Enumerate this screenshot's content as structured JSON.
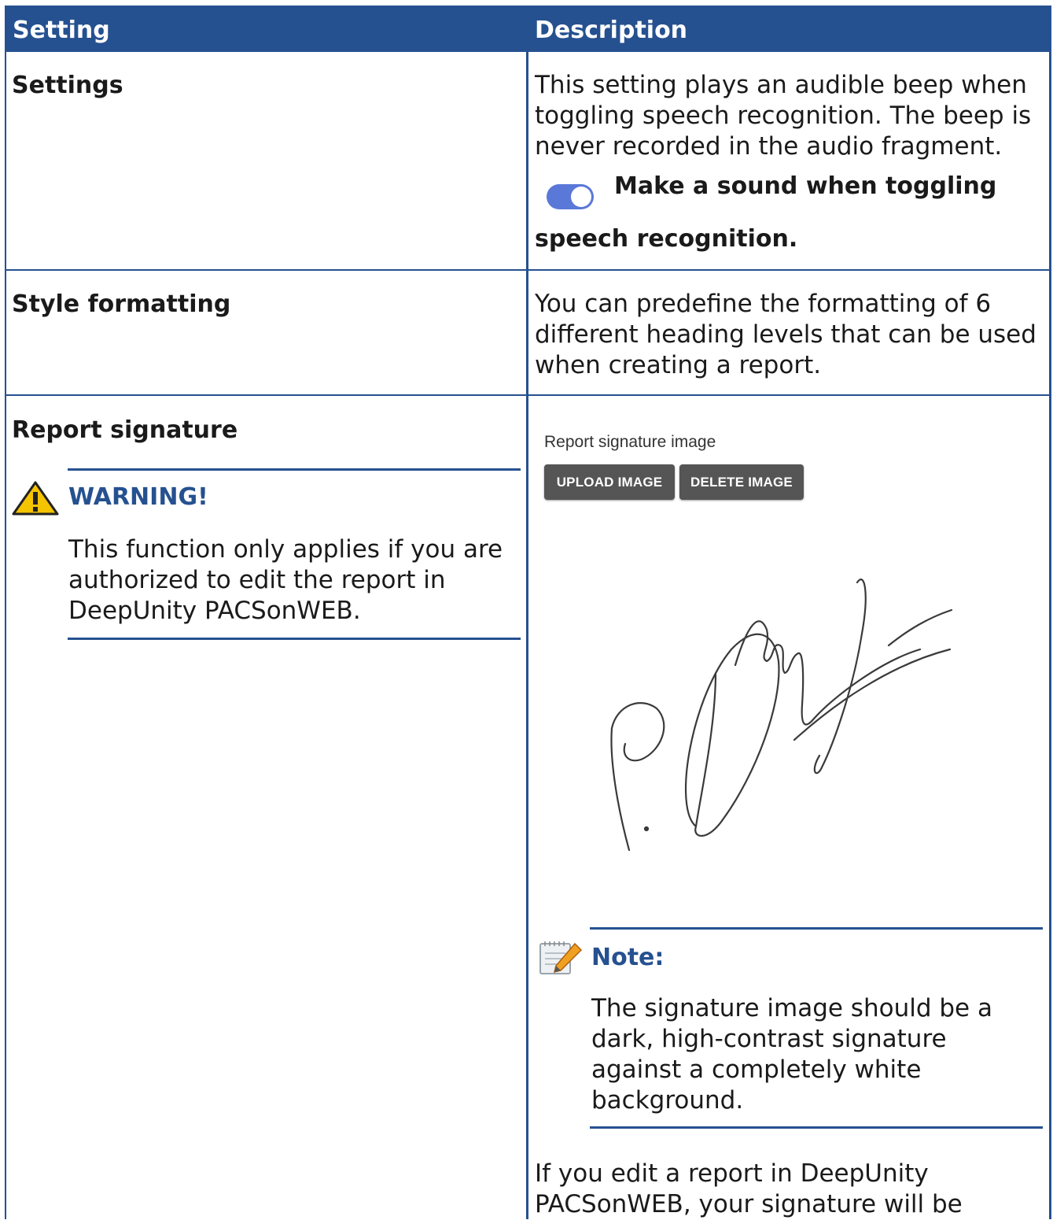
{
  "header": {
    "col_setting": "Setting",
    "col_description": "Description"
  },
  "rows": [
    {
      "setting": "Settings",
      "description": "This setting plays an audible beep when toggling speech recognition. The beep is never recorded in the audio fragment.",
      "toggle_label_line1": "Make a sound when toggling",
      "toggle_label_line2": "speech recognition.",
      "toggle_on": true
    },
    {
      "setting": "Style formatting",
      "description": "You can predefine the formatting of 6 different heading levels that can be used when creating a report."
    },
    {
      "setting": "Report signature",
      "warning": {
        "title": "WARNING!",
        "text": "This function only applies if you are authorized to edit the report in DeepUnity PACSonWEB."
      },
      "signature_panel": {
        "label": "Report signature image",
        "upload_button": "UPLOAD IMAGE",
        "delete_button": "DELETE IMAGE"
      },
      "note": {
        "title": "Note:",
        "text": "The signature image should be a dark, high-contrast signature against a completely white background."
      },
      "footer_text": "If you edit a report in DeepUnity PACSonWEB, your signature will be"
    }
  ],
  "colors": {
    "header_bg": "#265190",
    "toggle_on": "#5a78d8",
    "button_bg": "#555555",
    "warning_yellow": "#f5c400"
  },
  "icons": [
    "warning-icon",
    "note-icon"
  ]
}
